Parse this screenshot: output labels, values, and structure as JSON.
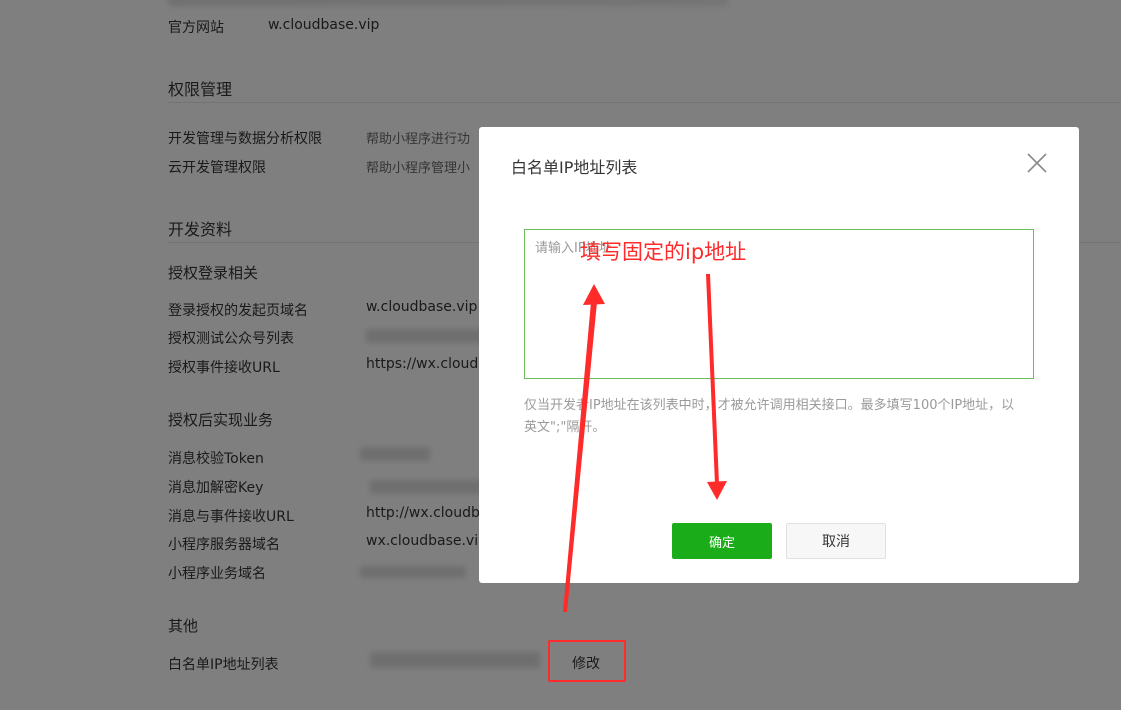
{
  "basic": {
    "website_label": "官方网站",
    "website_value": "w.cloudbase.vip"
  },
  "permissions": {
    "title": "权限管理",
    "items": [
      {
        "label": "开发管理与数据分析权限",
        "value": "帮助小程序进行功"
      },
      {
        "label": "云开发管理权限",
        "value": "帮助小程序管理小"
      }
    ]
  },
  "dev_info": {
    "title": "开发资料",
    "auth_login": {
      "title": "授权登录相关",
      "items": [
        {
          "label": "登录授权的发起页域名",
          "value": "w.cloudbase.vip"
        },
        {
          "label": "授权测试公众号列表",
          "value": ""
        },
        {
          "label": "授权事件接收URL",
          "value": "https://wx.cloudb"
        }
      ]
    },
    "auth_business": {
      "title": "授权后实现业务",
      "items": [
        {
          "label": "消息校验Token",
          "value": ""
        },
        {
          "label": "消息加解密Key",
          "value": ""
        },
        {
          "label": "消息与事件接收URL",
          "value": "http://wx.cloudb"
        },
        {
          "label": "小程序服务器域名",
          "value": "wx.cloudbase.vip"
        },
        {
          "label": "小程序业务域名",
          "value": ""
        }
      ]
    },
    "other": {
      "title": "其他",
      "whitelist_label": "白名单IP地址列表",
      "modify_label": "修改"
    }
  },
  "dialog": {
    "title": "白名单IP地址列表",
    "textarea_placeholder": "请输入IP地址",
    "hint": "仅当开发者IP地址在该列表中时，才被允许调用相关接口。最多填写100个IP地址，以英文\";\"隔开。",
    "ok_label": "确定",
    "cancel_label": "取消",
    "close_icon": "close-icon"
  },
  "annotation": {
    "text": "填写固定的ip地址",
    "color": "#ff2a2a"
  },
  "colors": {
    "primary_button": "#1aad19",
    "focus_border": "#6cbe5b",
    "annotation": "#ff2a2a"
  }
}
